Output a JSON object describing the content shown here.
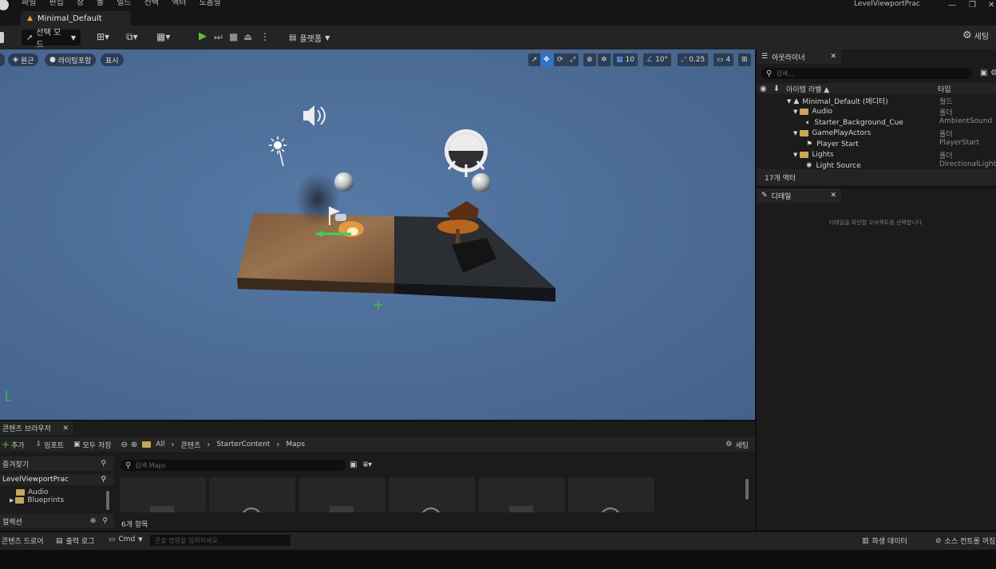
{
  "menu": [
    "파일",
    "편집",
    "창",
    "툴",
    "빌드",
    "선택",
    "액터",
    "도움말"
  ],
  "project_name": "LevelViewportPrac",
  "window_controls": [
    "—",
    "❐",
    "✕"
  ],
  "tab": {
    "title": "Minimal_Default"
  },
  "toolbar": {
    "mode_label": "선택 모드",
    "platform_label": "플랫폼",
    "settings_label": "세팅"
  },
  "viewport": {
    "perspective_label": "원근",
    "lit_label": "라이팅포함",
    "show_label": "표시",
    "grid_snap": "10",
    "rotation_snap": "10°",
    "scale_snap": "0.25",
    "camera_speed": "4"
  },
  "outliner": {
    "title": "아웃라이너",
    "search_placeholder": "검색...",
    "col_label": "아이템 라벨 ▲",
    "col_type": "타입",
    "rows": [
      {
        "label": "Minimal_Default (에디터)",
        "type": "월드"
      },
      {
        "label": "Audio",
        "type": "폴더"
      },
      {
        "label": "Starter_Background_Cue",
        "type": "AmbientSound"
      },
      {
        "label": "GamePlayActors",
        "type": "폴더"
      },
      {
        "label": "Player Start",
        "type": "PlayerStart"
      },
      {
        "label": "Lights",
        "type": "폴더"
      },
      {
        "label": "Light Source",
        "type": "DirectionalLight"
      }
    ],
    "actor_count": "17개 액터"
  },
  "details": {
    "title": "디테일",
    "empty_message": "디테일을 확인할 오브젝트를 선택합니다."
  },
  "content_browser": {
    "title": "콘텐츠 브라우저",
    "add_label": "추가",
    "import_label": "임포트",
    "save_all_label": "모두 저장",
    "breadcrumb": [
      "All",
      "콘텐츠",
      "StarterContent",
      "Maps"
    ],
    "settings_label": "세팅",
    "favorites_label": "즐겨찾기",
    "project_label": "LevelViewportPrac",
    "tree_items": [
      "Audio",
      "Blueprints"
    ],
    "collections_label": "컬렉션",
    "search_placeholder": "검색 Maps",
    "item_count": "6개 항목"
  },
  "statusbar": {
    "content_drawer": "콘텐츠 드로어",
    "output_log": "출력 로그",
    "cmd_label": "Cmd",
    "console_placeholder": "콘솔 명령을 입력하세요.",
    "derived_data": "파생 데이터",
    "source_control": "소스 컨트롤 꺼짐"
  },
  "colors": {
    "accent_blue": "#2f73c8",
    "play_green": "#5fbf3a",
    "folder_gold": "#c9a65a"
  }
}
